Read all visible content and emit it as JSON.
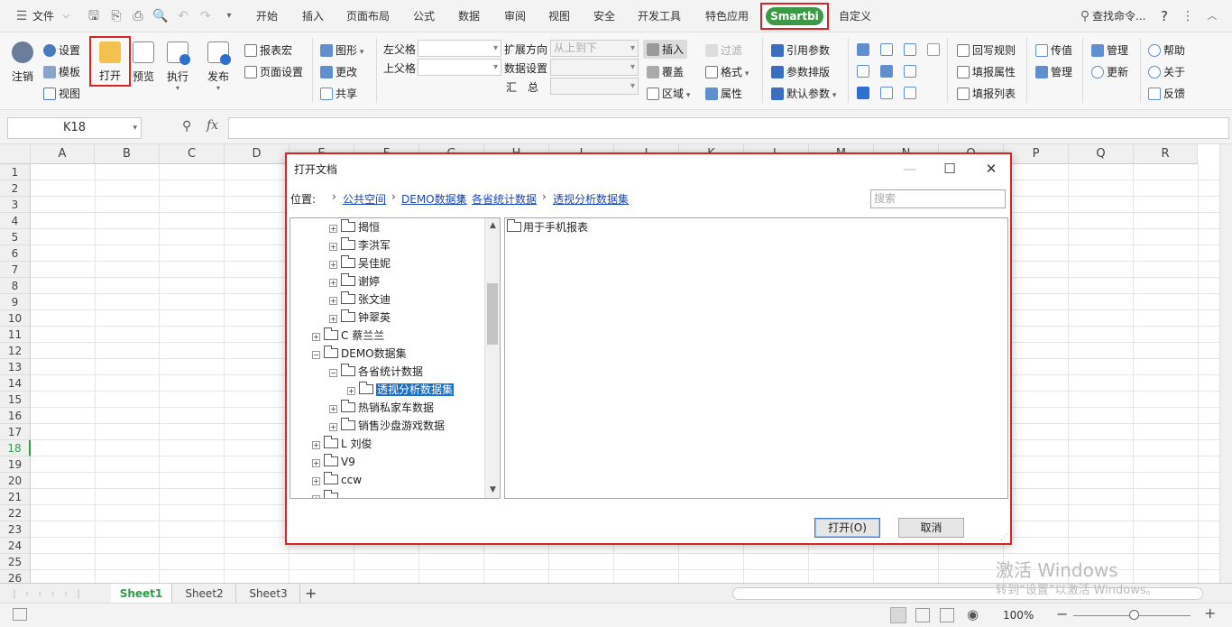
{
  "menubar": {
    "file": "文件",
    "tabs": [
      "开始",
      "插入",
      "页面布局",
      "公式",
      "数据",
      "审阅",
      "视图",
      "安全",
      "开发工具",
      "特色应用",
      "Smartbi",
      "自定义"
    ],
    "search": "查找命令...",
    "help": "?"
  },
  "ribbon": {
    "logout": "注销",
    "settings": "设置",
    "template": "模板",
    "view": "视图",
    "open": "打开",
    "preview": "预览",
    "execute": "执行",
    "publish": "发布",
    "report_macro": "报表宏",
    "page_setup": "页面设置",
    "graphic": "图形",
    "change": "更改",
    "share": "共享",
    "left_parent": "左父格",
    "top_parent": "上父格",
    "expand_dir": "扩展方向",
    "expand_value": "从上到下",
    "data_setting": "数据设置",
    "summary": "汇　总",
    "insert": "插入",
    "cover": "覆盖",
    "region": "区域",
    "filter": "过滤",
    "format": "格式",
    "property": "属性",
    "quote_param": "引用参数",
    "param_layout": "参数排版",
    "default_param": "默认参数",
    "writeback_rule": "回写规则",
    "fill_property": "填报属性",
    "fill_list": "填报列表",
    "pass_value": "传值",
    "manage": "管理",
    "manage2": "管理",
    "update": "更新",
    "help": "帮助",
    "about": "关于",
    "feedback": "反馈"
  },
  "formula": {
    "cell_ref": "K18",
    "fx": "fx"
  },
  "grid": {
    "columns": [
      "A",
      "B",
      "C",
      "D",
      "E",
      "F",
      "G",
      "H",
      "I",
      "J",
      "K",
      "L",
      "M",
      "N",
      "O",
      "P",
      "Q",
      "R"
    ],
    "rows": [
      "1",
      "2",
      "3",
      "4",
      "5",
      "6",
      "7",
      "8",
      "9",
      "10",
      "11",
      "12",
      "13",
      "14",
      "15",
      "16",
      "17",
      "18",
      "19",
      "20",
      "21",
      "22",
      "23",
      "24",
      "25",
      "26"
    ],
    "active_row": "18"
  },
  "sheets": [
    "Sheet1",
    "Sheet2",
    "Sheet3"
  ],
  "status": {
    "zoom": "100%"
  },
  "watermark": {
    "line1": "激活 Windows",
    "line2": "转到“设置”以激活 Windows。"
  },
  "dialog": {
    "title": "打开文档",
    "location_label": "位置:",
    "breadcrumb": [
      "公共空间",
      "DEMO数据集",
      "各省统计数据",
      "透视分析数据集"
    ],
    "search_placeholder": "搜索",
    "tree": [
      {
        "label": "揭恒",
        "level": 2,
        "selected": false
      },
      {
        "label": "李洪军",
        "level": 2,
        "selected": false
      },
      {
        "label": "吴佳妮",
        "level": 2,
        "selected": false
      },
      {
        "label": "谢婷",
        "level": 2,
        "selected": false
      },
      {
        "label": "张文迪",
        "level": 2,
        "selected": false
      },
      {
        "label": "钟翠英",
        "level": 2,
        "selected": false
      },
      {
        "label": "C 蔡兰兰",
        "level": 1,
        "selected": false
      },
      {
        "label": "DEMO数据集",
        "level": 1,
        "selected": false
      },
      {
        "label": "各省统计数据",
        "level": 2,
        "selected": false
      },
      {
        "label": "透视分析数据集",
        "level": 3,
        "selected": true
      },
      {
        "label": "热销私家车数据",
        "level": 2,
        "selected": false
      },
      {
        "label": "销售沙盘游戏数据",
        "level": 2,
        "selected": false
      },
      {
        "label": "L 刘俊",
        "level": 1,
        "selected": false
      },
      {
        "label": "V9",
        "level": 1,
        "selected": false
      },
      {
        "label": "ccw",
        "level": 1,
        "selected": false
      },
      {
        "label": "",
        "level": 1,
        "selected": false
      }
    ],
    "files": [
      "用于手机报表"
    ],
    "open_button": "打开(O)",
    "cancel_button": "取消"
  }
}
